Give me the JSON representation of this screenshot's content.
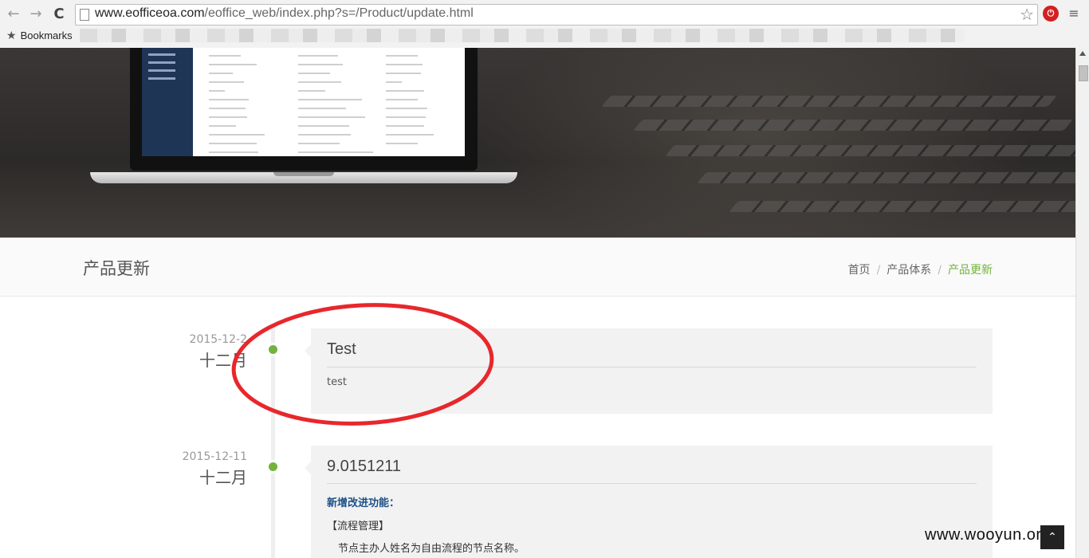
{
  "browser": {
    "url_domain": "www.eofficeoa.com",
    "url_path": "/eoffice_web/index.php?s=/Product/update.html",
    "bookmarks_label": "Bookmarks",
    "back_glyph": "←",
    "forward_glyph": "→",
    "reload_glyph": "C",
    "star_glyph": "☆",
    "menu_glyph": "≡",
    "ext_glyph": "⏻"
  },
  "page": {
    "title": "产品更新",
    "breadcrumb": [
      "首页",
      "产品体系",
      "产品更新"
    ],
    "breadcrumb_separator": "/"
  },
  "timeline": [
    {
      "date": "2015-12-2",
      "month": "十二月",
      "title": "Test",
      "body": "test"
    },
    {
      "date": "2015-12-11",
      "month": "十二月",
      "title": "9.0151211",
      "feature_heading": "新增改进功能：",
      "section": "【流程管理】",
      "item": "节点主办人姓名为自由流程的节点名称。"
    }
  ],
  "watermark": "www.wooyun.org",
  "back_to_top_glyph": "⌃",
  "colors": {
    "accent_green": "#72b33c",
    "annotation_red": "#e8272c",
    "feature_blue": "#1c4f86"
  }
}
